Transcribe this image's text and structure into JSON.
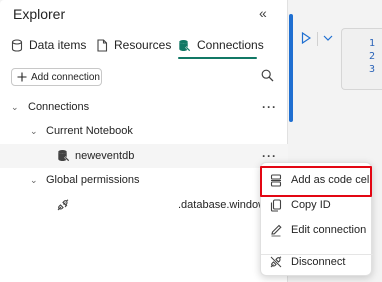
{
  "explorer": {
    "title": "Explorer",
    "collapse_glyph": "«",
    "tabs": [
      {
        "label": "Data items",
        "icon": "cylinder-icon"
      },
      {
        "label": "Resources",
        "icon": "document-icon"
      },
      {
        "label": "Connections",
        "icon": "database-link-icon",
        "active": true
      }
    ],
    "add_connection_label": "Add connection",
    "tree": {
      "root_label": "Connections",
      "current_notebook_label": "Current Notebook",
      "connection_name": "neweventdb",
      "global_permissions_label": "Global permissions",
      "global_item_text": ".database.windows"
    },
    "more_glyph": "···"
  },
  "editor": {
    "line_numbers": [
      "1",
      "2",
      "3"
    ]
  },
  "context_menu": {
    "items": [
      {
        "label": "Add as code cell",
        "icon": "code-cell-icon",
        "highlighted": true
      },
      {
        "label": "Copy ID",
        "icon": "copy-icon"
      },
      {
        "label": "Edit connection",
        "icon": "pencil-icon"
      },
      {
        "label": "Disconnect",
        "icon": "plug-disconnect-icon"
      }
    ]
  },
  "colors": {
    "accent": "#117865",
    "highlight_border": "#e30613",
    "editor_blue": "#1f6fd1"
  }
}
